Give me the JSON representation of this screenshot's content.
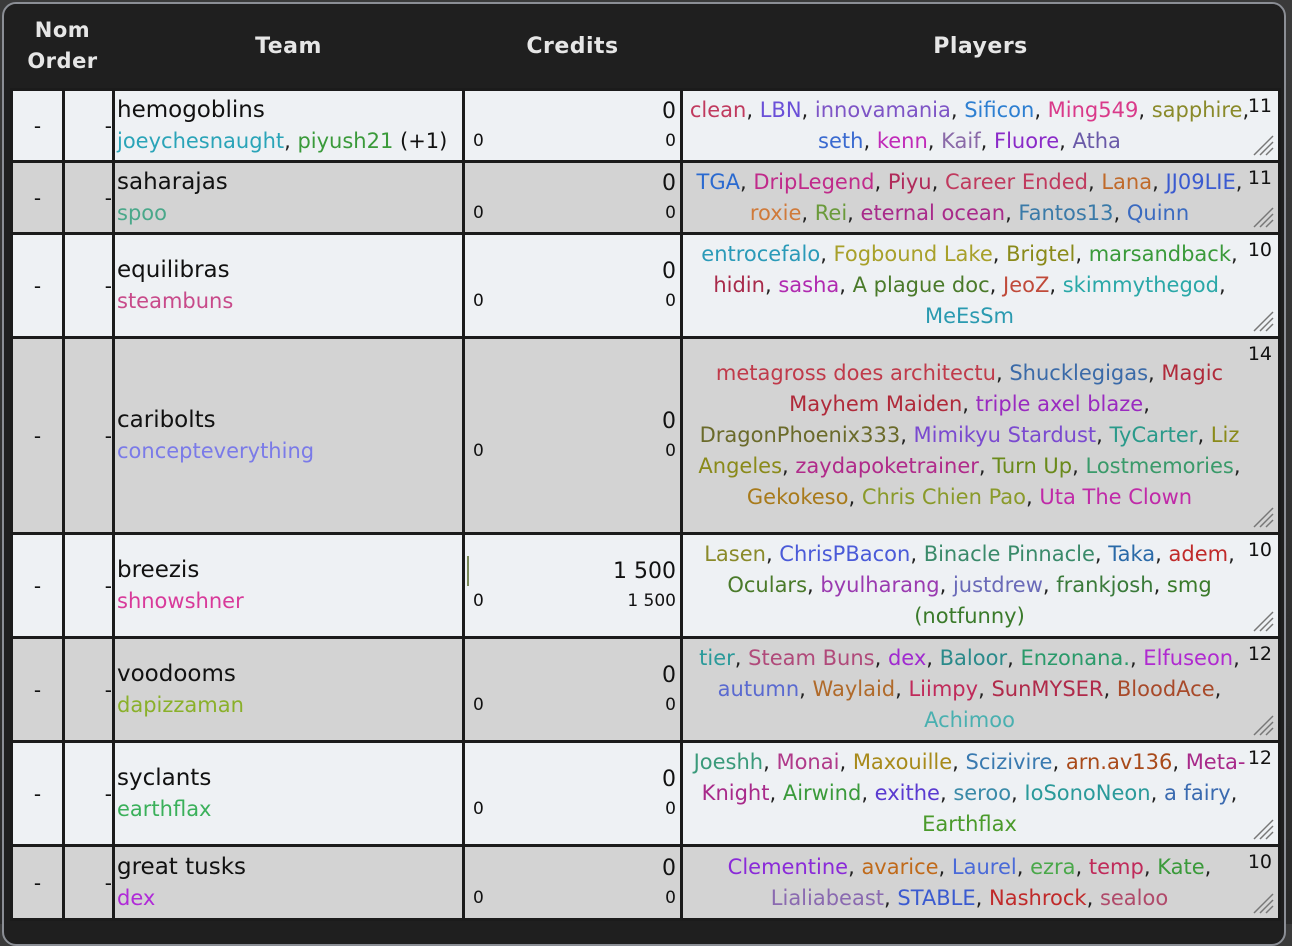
{
  "header": {
    "nom_order_line1": "Nom",
    "nom_order_line2": "Order",
    "team": "Team",
    "credits": "Credits",
    "players": "Players"
  },
  "rows": [
    {
      "nom1": "-",
      "nom2": "-",
      "team": "hemogoblins",
      "coaches": [
        {
          "name": "joeychesnaught",
          "color": "#2aa4b8"
        },
        {
          "name": "piyush21",
          "color": "#3a9a3a"
        }
      ],
      "coach_extra": "(+1)",
      "credits_main": "0",
      "credits_left": "0",
      "credits_right": "0",
      "count": "11",
      "tone": "light",
      "players": [
        {
          "name": "clean",
          "color": "#c03a5e"
        },
        {
          "name": "LBN",
          "color": "#6a4fd8"
        },
        {
          "name": "innovamania",
          "color": "#7e55c6"
        },
        {
          "name": "Sificon",
          "color": "#2d7fd1"
        },
        {
          "name": "Ming549",
          "color": "#d93a8a"
        },
        {
          "name": "sapphire",
          "color": "#8a8a2a"
        },
        {
          "name": "seth",
          "color": "#3a6ad0"
        },
        {
          "name": "kenn",
          "color": "#c02ab8"
        },
        {
          "name": "Kaif",
          "color": "#8a6aa8"
        },
        {
          "name": "Fluore",
          "color": "#8a2ac8"
        },
        {
          "name": "Atha",
          "color": "#6a5aa8"
        }
      ]
    },
    {
      "nom1": "-",
      "nom2": "-",
      "team": "saharajas",
      "coaches": [
        {
          "name": "spoo",
          "color": "#4aa88a"
        }
      ],
      "coach_extra": "",
      "credits_main": "0",
      "credits_left": "0",
      "credits_right": "0",
      "count": "11",
      "tone": "dark",
      "players": [
        {
          "name": "TGA",
          "color": "#2a6ad0"
        },
        {
          "name": "DripLegend",
          "color": "#c02a8a"
        },
        {
          "name": "Piyu",
          "color": "#b02a5a"
        },
        {
          "name": "Career Ended",
          "color": "#c03a5e"
        },
        {
          "name": "Lana",
          "color": "#c06a2a"
        },
        {
          "name": "JJ09LIE",
          "color": "#3a5ad0"
        },
        {
          "name": "roxie",
          "color": "#d07a3a"
        },
        {
          "name": "Rei",
          "color": "#6a9a3a"
        },
        {
          "name": "eternal ocean",
          "color": "#a82a8a"
        },
        {
          "name": "Fantos13",
          "color": "#3a7aa8"
        },
        {
          "name": "Quinn",
          "color": "#3a6ac0"
        }
      ]
    },
    {
      "nom1": "-",
      "nom2": "-",
      "team": "equilibras",
      "coaches": [
        {
          "name": "steambuns",
          "color": "#c84a8a"
        }
      ],
      "coach_extra": "",
      "credits_main": "0",
      "credits_left": "0",
      "credits_right": "0",
      "count": "10",
      "tone": "light",
      "players": [
        {
          "name": "entrocefalo",
          "color": "#2a9ab8"
        },
        {
          "name": "Fogbound Lake",
          "color": "#a8a02a"
        },
        {
          "name": "Brigtel",
          "color": "#8a8a1a"
        },
        {
          "name": "marsandback",
          "color": "#3a9a3a"
        },
        {
          "name": "hidin",
          "color": "#a82a4a"
        },
        {
          "name": "sasha",
          "color": "#b02ab0"
        },
        {
          "name": "A plague doc",
          "color": "#4a7a2a"
        },
        {
          "name": "JeoZ",
          "color": "#c04a3a"
        },
        {
          "name": "skimmythegod",
          "color": "#2aa8a8"
        },
        {
          "name": "MeEsSm",
          "color": "#2a9ab0"
        }
      ]
    },
    {
      "nom1": "-",
      "nom2": "-",
      "team": "caribolts",
      "coaches": [
        {
          "name": "concepteverything",
          "color": "#7a7ae8"
        }
      ],
      "coach_extra": "",
      "credits_main": "0",
      "credits_left": "0",
      "credits_right": "0",
      "count": "14",
      "tone": "dark",
      "players": [
        {
          "name": "metagross does architectu",
          "color": "#c03a4a"
        },
        {
          "name": "Shucklegigas",
          "color": "#3a6aa8"
        },
        {
          "name": "Magic Mayhem Maiden",
          "color": "#b02a3a"
        },
        {
          "name": "triple axel blaze",
          "color": "#9a2ac0"
        },
        {
          "name": "DragonPhoenix333",
          "color": "#6a6a2a"
        },
        {
          "name": "Mimikyu Stardust",
          "color": "#7a4ad0"
        },
        {
          "name": "TyCarter",
          "color": "#2a9a8a"
        },
        {
          "name": "Liz Angeles",
          "color": "#8a8a1a"
        },
        {
          "name": "zaydapoketrainer",
          "color": "#b02a8a"
        },
        {
          "name": "Turn Up",
          "color": "#6a8a1a"
        },
        {
          "name": "Lostmemories",
          "color": "#3a9a6a"
        },
        {
          "name": "Gekokeso",
          "color": "#a87a1a"
        },
        {
          "name": "Chris Chien Pao",
          "color": "#8a9a2a"
        },
        {
          "name": "Uta The Clown",
          "color": "#c02aa8"
        }
      ]
    },
    {
      "nom1": "-",
      "nom2": "-",
      "team": "breezis",
      "coaches": [
        {
          "name": "shnowshner",
          "color": "#d83a9a"
        }
      ],
      "coach_extra": "",
      "credits_main": "1 500",
      "credits_left": "0",
      "credits_right": "1 500",
      "count": "10",
      "tone": "light",
      "bar": true,
      "players": [
        {
          "name": "Lasen",
          "color": "#8a8a2a"
        },
        {
          "name": "ChrisPBacon",
          "color": "#4a5ad8"
        },
        {
          "name": "Binacle Pinnacle",
          "color": "#3a8a6a"
        },
        {
          "name": "Taka",
          "color": "#2a6aa8"
        },
        {
          "name": "adem",
          "color": "#c02a2a"
        },
        {
          "name": "Oculars",
          "color": "#4a7a2a"
        },
        {
          "name": "byulharang",
          "color": "#9a3ab0"
        },
        {
          "name": "justdrew",
          "color": "#6a6ab8"
        },
        {
          "name": "frankjosh",
          "color": "#3a7a3a"
        },
        {
          "name": "smg (notfunny)",
          "color": "#3a7a2a"
        }
      ]
    },
    {
      "nom1": "-",
      "nom2": "-",
      "team": "voodooms",
      "coaches": [
        {
          "name": "dapizzaman",
          "color": "#8ab02a"
        }
      ],
      "coach_extra": "",
      "credits_main": "0",
      "credits_left": "0",
      "credits_right": "0",
      "count": "12",
      "tone": "dark",
      "players": [
        {
          "name": "tier",
          "color": "#2a9a9a"
        },
        {
          "name": "Steam Buns",
          "color": "#b04a7a"
        },
        {
          "name": "dex",
          "color": "#a02ad0"
        },
        {
          "name": "Baloor",
          "color": "#2a8a8a"
        },
        {
          "name": "Enzonana.",
          "color": "#2a9a6a"
        },
        {
          "name": "Elfuseon",
          "color": "#b02ad0"
        },
        {
          "name": "autumn",
          "color": "#5a6ad0"
        },
        {
          "name": "Waylaid",
          "color": "#b06a2a"
        },
        {
          "name": "Liimpy",
          "color": "#c02a5a"
        },
        {
          "name": "SunMYSER",
          "color": "#b02a4a"
        },
        {
          "name": "BloodAce",
          "color": "#a84a2a"
        },
        {
          "name": "Achimoo",
          "color": "#4ab0b0"
        }
      ]
    },
    {
      "nom1": "-",
      "nom2": "-",
      "team": "syclants",
      "coaches": [
        {
          "name": "earthflax",
          "color": "#3ab05a"
        }
      ],
      "coach_extra": "",
      "credits_main": "0",
      "credits_left": "0",
      "credits_right": "0",
      "count": "12",
      "tone": "light",
      "players": [
        {
          "name": "Joeshh",
          "color": "#3a9a7a"
        },
        {
          "name": "Monai",
          "color": "#b03a8a"
        },
        {
          "name": "Maxouille",
          "color": "#a88a1a"
        },
        {
          "name": "Scizivire",
          "color": "#3a7ab0"
        },
        {
          "name": "arn.av136",
          "color": "#a84a1a"
        },
        {
          "name": "Meta-Knight",
          "color": "#a82a8a"
        },
        {
          "name": "Airwind",
          "color": "#3a9a3a"
        },
        {
          "name": "exithe",
          "color": "#5a3ad0"
        },
        {
          "name": "seroo",
          "color": "#3a8aa8"
        },
        {
          "name": "IoSonoNeon",
          "color": "#2a9a9a"
        },
        {
          "name": "a fairy",
          "color": "#3a6ab0"
        },
        {
          "name": "Earthflax",
          "color": "#4a9a2a"
        }
      ]
    },
    {
      "nom1": "-",
      "nom2": "-",
      "team": "great tusks",
      "coaches": [
        {
          "name": "dex",
          "color": "#b02ad8"
        }
      ],
      "coach_extra": "",
      "credits_main": "0",
      "credits_left": "0",
      "credits_right": "0",
      "count": "10",
      "tone": "dark",
      "players": [
        {
          "name": "Clementine",
          "color": "#8a2ad8"
        },
        {
          "name": "avarice",
          "color": "#c06a1a"
        },
        {
          "name": "Laurel",
          "color": "#4a6ad8"
        },
        {
          "name": "ezra",
          "color": "#4aa84a"
        },
        {
          "name": "temp",
          "color": "#c02a5a"
        },
        {
          "name": "Kate",
          "color": "#3a9a3a"
        },
        {
          "name": "Lialiabeast",
          "color": "#8a6ab0"
        },
        {
          "name": "STABLE",
          "color": "#3a5ad0"
        },
        {
          "name": "Nashrock",
          "color": "#c02a2a"
        },
        {
          "name": "sealoo",
          "color": "#b04a6a"
        }
      ]
    }
  ],
  "icons": {
    "resize": "resize-grip-icon"
  }
}
